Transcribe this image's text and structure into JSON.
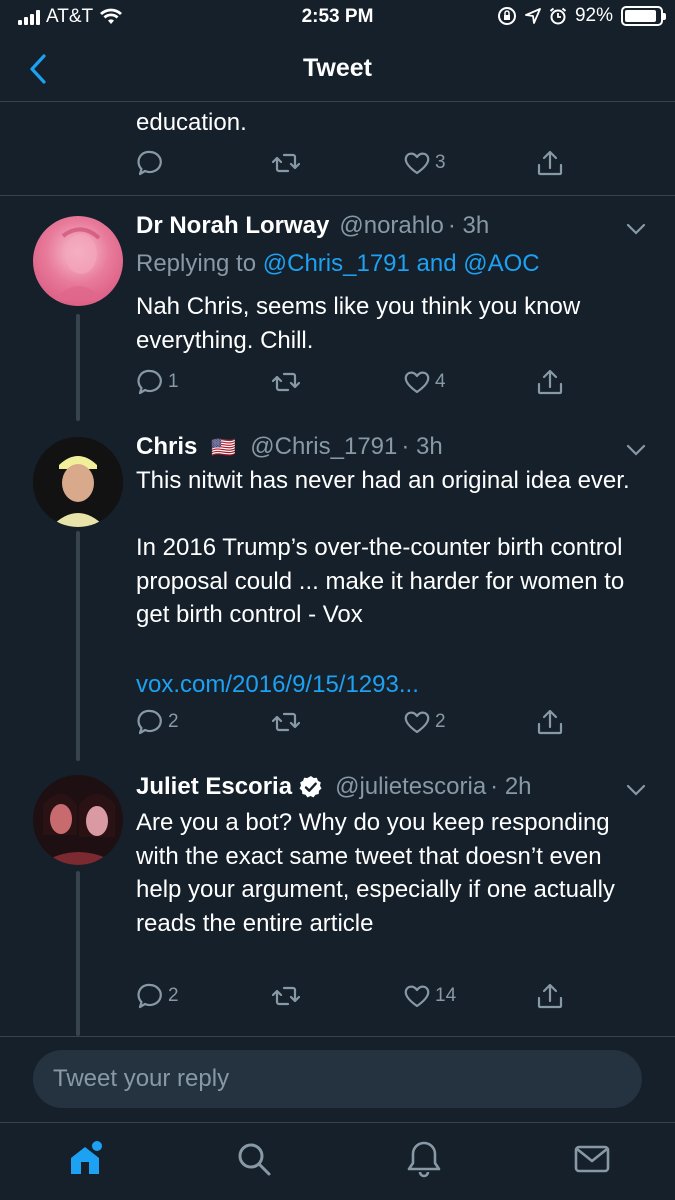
{
  "status": {
    "carrier": "AT&T",
    "time": "2:53 PM",
    "battery": "92%",
    "battery_level": 0.92
  },
  "nav": {
    "title": "Tweet"
  },
  "top_tweet": {
    "text_tail": "education.",
    "likes": "3"
  },
  "tweets": [
    {
      "name": "Dr Norah Lorway",
      "handle": "@norahlo",
      "time": "· 3h",
      "replying_label": "Replying to",
      "replying_to": "@Chris_1791 and @AOC",
      "text": "Nah Chris, seems like you think you know everything. Chill.",
      "replies": "1",
      "retweets": "",
      "likes": "4"
    },
    {
      "name": "Chris",
      "flag": "🇺🇸",
      "handle": "@Chris_1791",
      "time": "· 3h",
      "text": "This nitwit has never had an original idea ever.\n\nIn 2016 Trump’s over-the-counter birth control proposal could ... make it harder for women to get birth control - Vox",
      "link": "vox.com/2016/9/15/1293...",
      "replies": "2",
      "retweets": "",
      "likes": "2"
    },
    {
      "name": "Juliet Escoria",
      "verified": true,
      "handle": "@julietescoria",
      "time": "· 2h",
      "text": "Are you a bot? Why do you keep responding with the exact same tweet that doesn’t even help your argument, especially if one actually reads the entire article",
      "replies": "2",
      "retweets": "",
      "likes": "14"
    }
  ],
  "reply_bar": {
    "placeholder": "Tweet your reply"
  },
  "tabs": [
    {
      "icon": "home-icon",
      "active": true
    },
    {
      "icon": "search-icon",
      "active": false
    },
    {
      "icon": "notifications-bell-icon",
      "active": false
    },
    {
      "icon": "messages-envelope-icon",
      "active": false
    }
  ],
  "colors": {
    "background": "#15202b",
    "accent": "#1da1f2",
    "secondary_text": "#8899a6",
    "divider": "#38444d"
  }
}
